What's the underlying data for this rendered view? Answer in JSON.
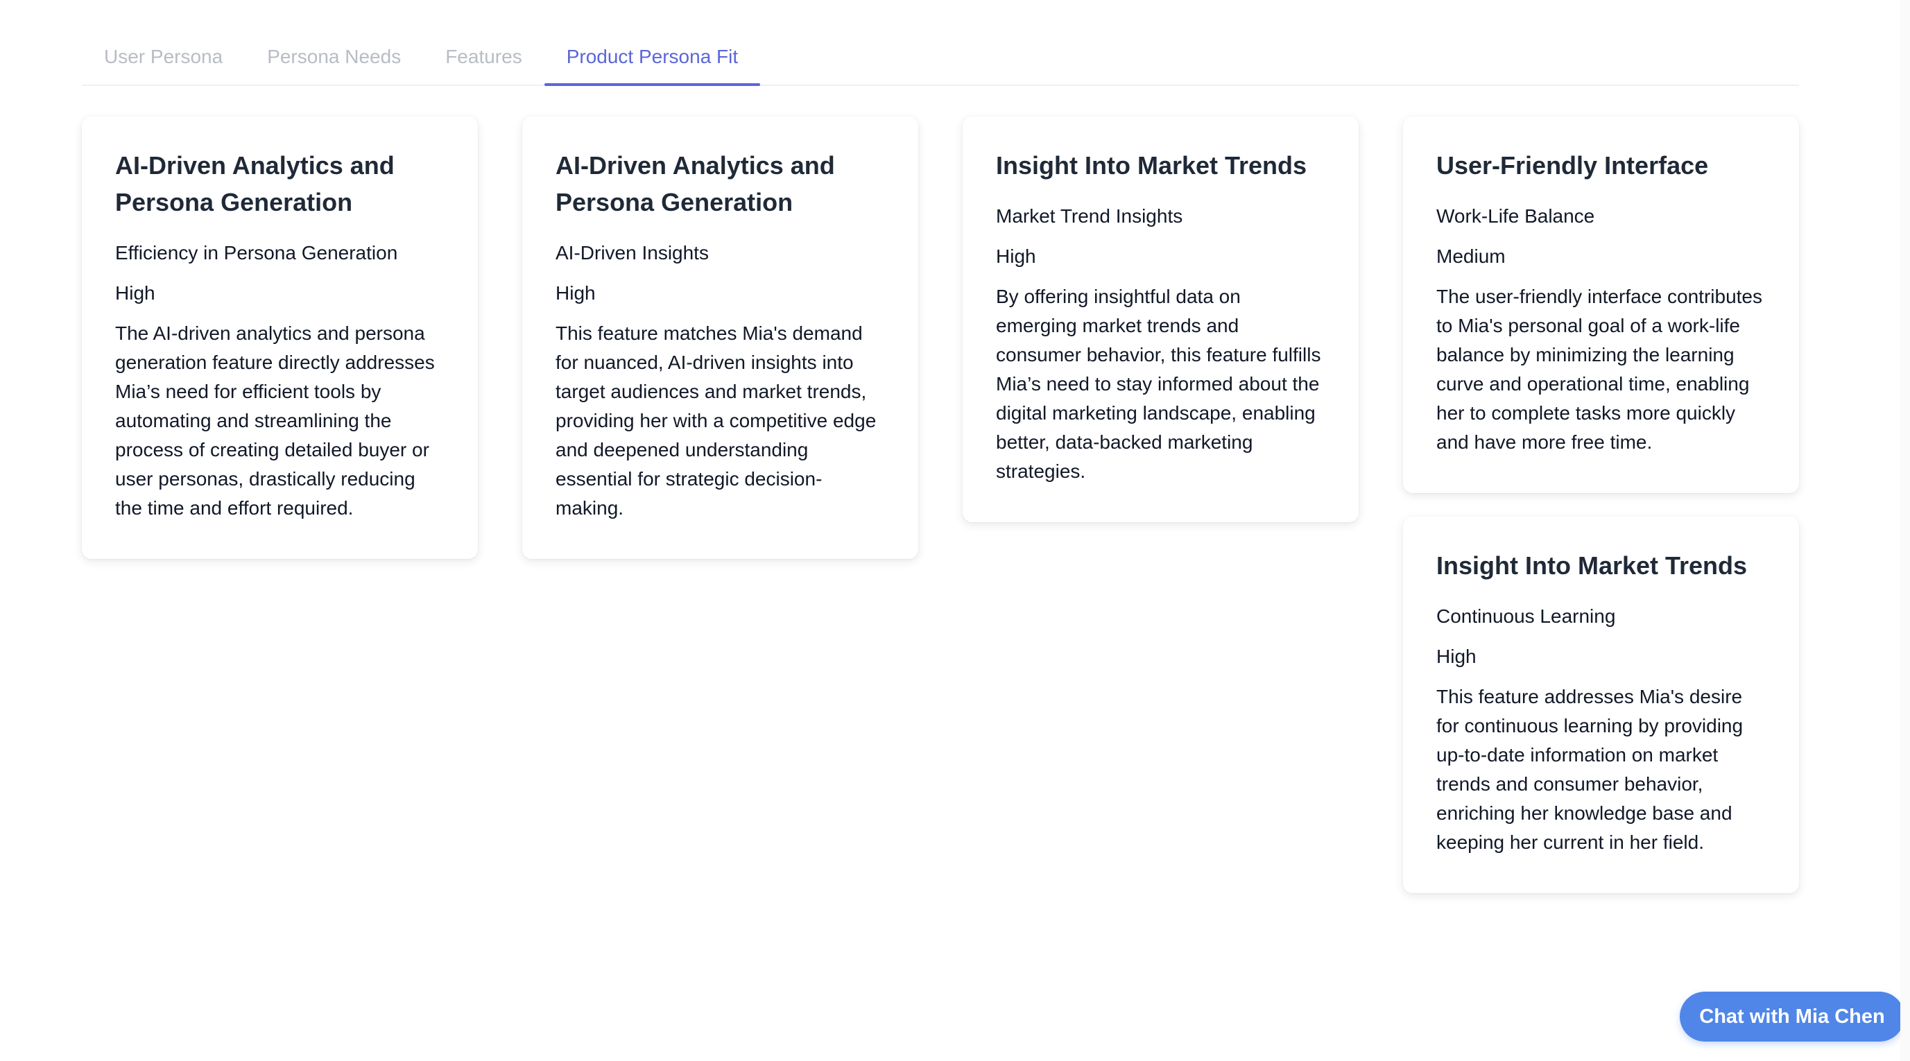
{
  "tabs": [
    {
      "label": "User Persona",
      "active": false
    },
    {
      "label": "Persona Needs",
      "active": false
    },
    {
      "label": "Features",
      "active": false
    },
    {
      "label": "Product Persona Fit",
      "active": true
    }
  ],
  "cards": {
    "col1": [
      {
        "title": "AI-Driven Analytics and Persona Generation",
        "need": "Efficiency in Persona Generation",
        "level": "High",
        "description": "The AI-driven analytics and persona generation feature directly addresses Mia’s need for efficient tools by automating and streamlining the process of creating detailed buyer or user personas, drastically reducing the time and effort required."
      }
    ],
    "col2": [
      {
        "title": "AI-Driven Analytics and Persona Generation",
        "need": "AI-Driven Insights",
        "level": "High",
        "description": "This feature matches Mia's demand for nuanced, AI-driven insights into target audiences and market trends, providing her with a competitive edge and deepened understanding essential for strategic decision-making."
      }
    ],
    "col3": [
      {
        "title": "Insight Into Market Trends",
        "need": "Market Trend Insights",
        "level": "High",
        "description": "By offering insightful data on emerging market trends and consumer behavior, this feature fulfills Mia’s need to stay informed about the digital marketing landscape, enabling better, data-backed marketing strategies."
      }
    ],
    "col4": [
      {
        "title": "User-Friendly Interface",
        "need": "Work-Life Balance",
        "level": "Medium",
        "description": "The user-friendly interface contributes to Mia's personal goal of a work-life balance by minimizing the learning curve and operational time, enabling her to complete tasks more quickly and have more free time."
      },
      {
        "title": "Insight Into Market Trends",
        "need": "Continuous Learning",
        "level": "High",
        "description": "This feature addresses Mia's desire for continuous learning by providing up-to-date information on market trends and consumer behavior, enriching her knowledge base and keeping her current in her field."
      }
    ]
  },
  "chat_button": {
    "label": "Chat with Mia Chen"
  },
  "colors": {
    "accent": "#5a67d8",
    "chat_button": "#4f86e8",
    "inactive_tab": "#b8bcc4"
  }
}
